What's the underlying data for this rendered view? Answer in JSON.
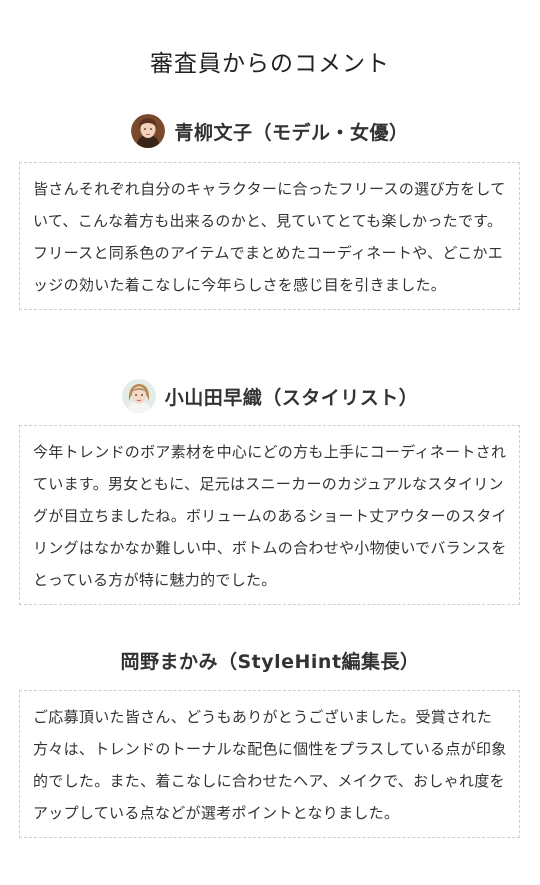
{
  "page": {
    "title": "審査員からのコメント"
  },
  "judges": [
    {
      "name": "青柳文子（モデル・女優）",
      "avatar_icon": "portrait-photo",
      "comment": "皆さんそれぞれ自分のキャラクターに合ったフリースの選び方をしていて、こんな着方も出来るのかと、見ていてとても楽しかったです。フリースと同系色のアイテムでまとめたコーディネートや、どこかエッジの効いた着こなしに今年らしさを感じ目を引きました。"
    },
    {
      "name": "小山田早織（スタイリスト）",
      "avatar_icon": "portrait-photo",
      "comment": "今年トレンドのボア素材を中心にどの方も上手にコーディネートされています。男女ともに、足元はスニーカーのカジュアルなスタイリングが目立ちましたね。ボリュームのあるショート丈アウターのスタイリングはなかなか難しい中、ボトムの合わせや小物使いでバランスをとっている方が特に魅力的でした。"
    },
    {
      "name": "岡野まかみ（StyleHint編集長）",
      "comment": "ご応募頂いた皆さん、どうもありがとうございました。受賞された方々は、トレンドのトーナルな配色に個性をプラスしている点が印象的でした。また、着こなしに合わせたヘア、メイクで、おしゃれ度をアップしている点などが選考ポイントとなりました。"
    }
  ]
}
